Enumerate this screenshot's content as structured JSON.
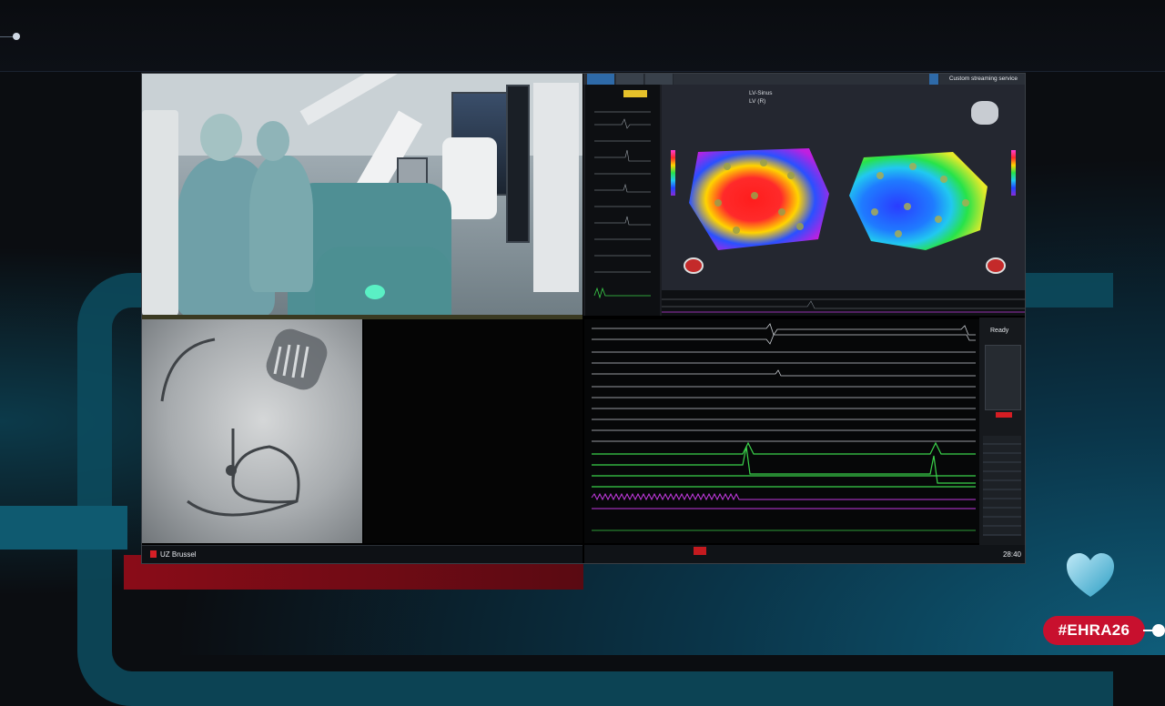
{
  "stream": {
    "top_right_label": "Custom streaming service",
    "map_header_primary": "LV-Sinus",
    "map_header_secondary": "LV (R)"
  },
  "recording": {
    "status_label": "Ready",
    "clock": "28:40"
  },
  "lower_bar": {
    "site_name": "UZ Brussel"
  },
  "event": {
    "hashtag": "#EHRA26"
  },
  "colors": {
    "brand_red": "#c8102e",
    "brand_teal": "#0f5a70",
    "egm_green": "#3bd14a",
    "egm_magenta": "#c23ae0"
  },
  "icons": {
    "logo": "heart-logo-icon",
    "site": "hospital-red-icon"
  }
}
